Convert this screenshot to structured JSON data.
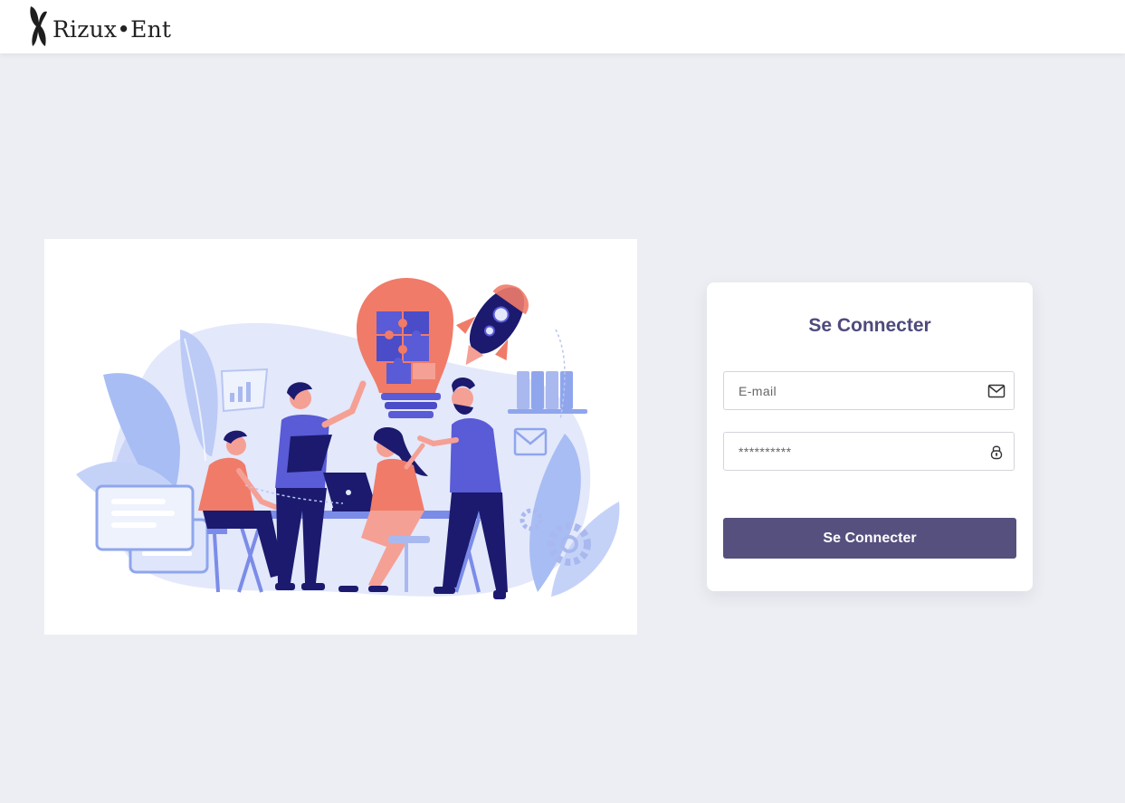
{
  "header": {
    "logo_text": "Rizux•Ent",
    "logo_icon": "brand-butterfly-icon"
  },
  "login": {
    "title": "Se Connecter",
    "email": {
      "placeholder": "E-mail",
      "value": "",
      "icon": "envelope-icon"
    },
    "password": {
      "placeholder": "**********",
      "value": "",
      "icon": "lock-icon"
    },
    "submit_label": "Se Connecter"
  },
  "colors": {
    "background": "#eceef3",
    "primary": "#56507e",
    "title": "#4e4a7d",
    "illustration_blue": "#5a5bd6",
    "illustration_coral": "#f07b69"
  }
}
